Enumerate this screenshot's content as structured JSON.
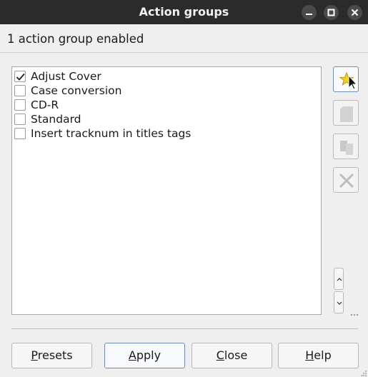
{
  "window": {
    "title": "Action groups"
  },
  "summary": "1 action group enabled",
  "groups": [
    {
      "label": "Adjust Cover",
      "checked": true
    },
    {
      "label": "Case conversion",
      "checked": false
    },
    {
      "label": "CD-R",
      "checked": false
    },
    {
      "label": "Standard",
      "checked": false
    },
    {
      "label": "Insert tracknum in titles tags",
      "checked": false
    }
  ],
  "toolbar": [
    "new-star-icon",
    "edit-icon",
    "copy-icon",
    "delete-icon"
  ],
  "buttons": {
    "presets": {
      "first": "P",
      "rest": "resets"
    },
    "apply": {
      "first": "A",
      "rest": "pply"
    },
    "close": {
      "first": "C",
      "rest": "lose"
    },
    "help": {
      "first": "H",
      "rest": "elp"
    }
  }
}
